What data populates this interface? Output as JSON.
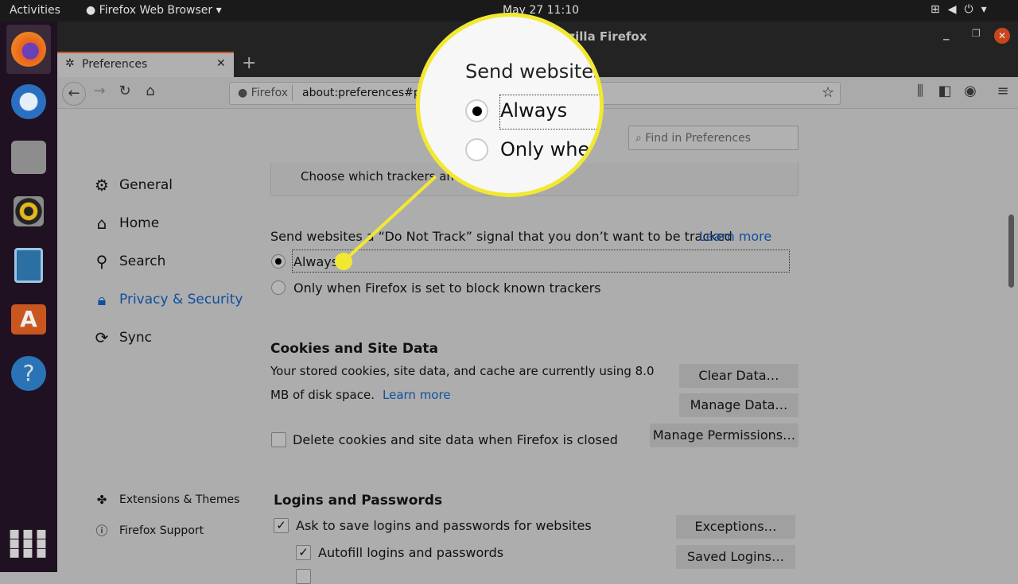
{
  "topbar": {
    "activities": "Activities",
    "app_menu": "Firefox Web Browser",
    "clock": "May 27  11:10"
  },
  "window": {
    "title": "Preferences - Mozilla Firefox"
  },
  "tab": {
    "label": "Preferences"
  },
  "urlbar": {
    "identity": "Firefox",
    "url": "about:preferences#privacy"
  },
  "search": {
    "placeholder": "Find in Preferences"
  },
  "sidebar": {
    "items": [
      {
        "label": "General",
        "icon": "gear-icon"
      },
      {
        "label": "Home",
        "icon": "home-icon"
      },
      {
        "label": "Search",
        "icon": "search-icon"
      },
      {
        "label": "Privacy & Security",
        "icon": "lock-icon",
        "active": true
      },
      {
        "label": "Sync",
        "icon": "sync-icon"
      }
    ],
    "footer": [
      {
        "label": "Extensions & Themes",
        "icon": "puzzle-icon"
      },
      {
        "label": "Firefox Support",
        "icon": "help-icon"
      }
    ]
  },
  "tracking": {
    "partial_text": "Choose which trackers and",
    "dnt_label": "Send websites a “Do Not Track” signal that you don’t want to be tracked",
    "learn_more": "Learn more",
    "options": [
      {
        "label": "Always",
        "checked": true
      },
      {
        "label": "Only when Firefox is set to block known trackers",
        "checked": false
      }
    ]
  },
  "cookies": {
    "heading": "Cookies and Site Data",
    "line1": "Your stored cookies, site data, and cache are currently using 8.0",
    "line2": "MB of disk space.",
    "learn_more": "Learn more",
    "clear": "Clear Data…",
    "manage": "Manage Data…",
    "permissions": "Manage Permissions…",
    "delete_label": "Delete cookies and site data when Firefox is closed"
  },
  "logins": {
    "heading": "Logins and Passwords",
    "ask": "Ask to save logins and passwords for websites",
    "autofill": "Autofill logins and passwords",
    "exceptions": "Exceptions…",
    "saved": "Saved Logins…"
  },
  "magnifier": {
    "heading": "Send websites",
    "always": "Always",
    "only": "Only whe"
  },
  "colors": {
    "highlight": "#f2e832",
    "accent": "#0f4f9e"
  }
}
